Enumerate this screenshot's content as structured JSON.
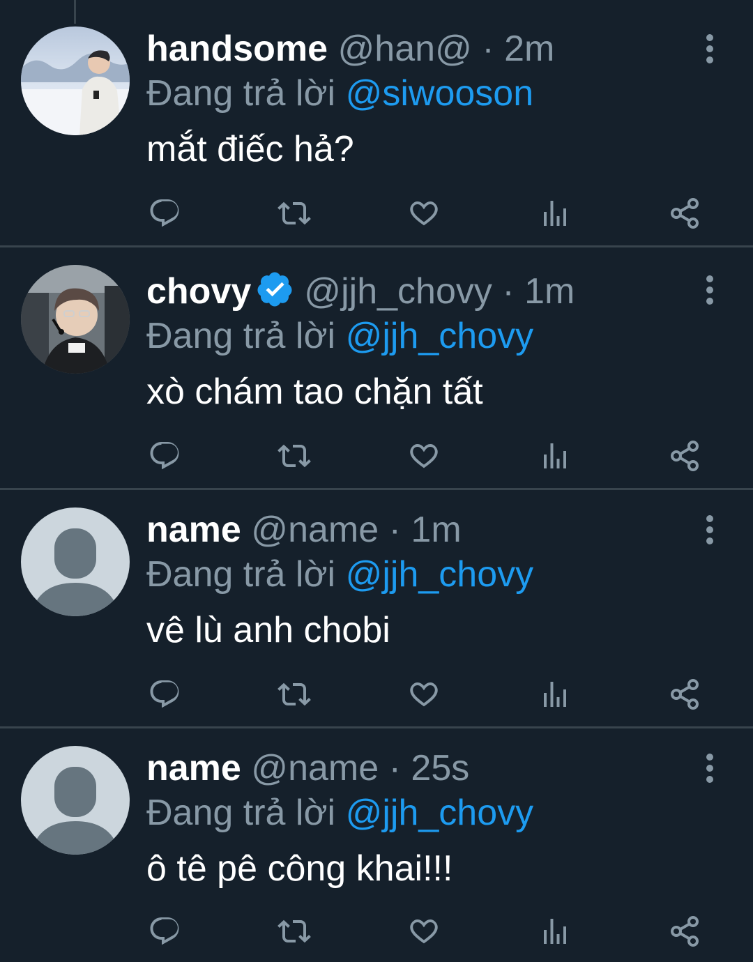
{
  "tweets": [
    {
      "display_name": "handsome",
      "handle": "@han@",
      "separator": "·",
      "time": "2m",
      "reply_prefix": "Đang trả lời",
      "reply_to": "@siwooson",
      "text": "mắt điếc hả?",
      "verified": false,
      "avatar": "photo"
    },
    {
      "display_name": "chovy",
      "handle": "@jjh_chovy",
      "separator": "·",
      "time": "1m",
      "reply_prefix": "Đang trả lời",
      "reply_to": "@jjh_chovy",
      "text": "xò chám tao chặn tất",
      "verified": true,
      "avatar": "photo"
    },
    {
      "display_name": "name",
      "handle": "@name",
      "separator": "·",
      "time": "1m",
      "reply_prefix": "Đang trả lời",
      "reply_to": "@jjh_chovy",
      "text": "vê lù anh chobi",
      "verified": false,
      "avatar": "default"
    },
    {
      "display_name": "name",
      "handle": "@name",
      "separator": "·",
      "time": "25s",
      "reply_prefix": "Đang trả lời",
      "reply_to": "@jjh_chovy",
      "text": "ô tê pê công khai!!!",
      "verified": false,
      "avatar": "default"
    }
  ],
  "actions": [
    "reply-icon",
    "retweet-icon",
    "like-icon",
    "analytics-icon",
    "share-icon"
  ],
  "colors": {
    "background": "#15202b",
    "divider": "#38444d",
    "primary_text": "#ffffff",
    "secondary_text": "#8899a6",
    "accent": "#1d9bf0"
  }
}
